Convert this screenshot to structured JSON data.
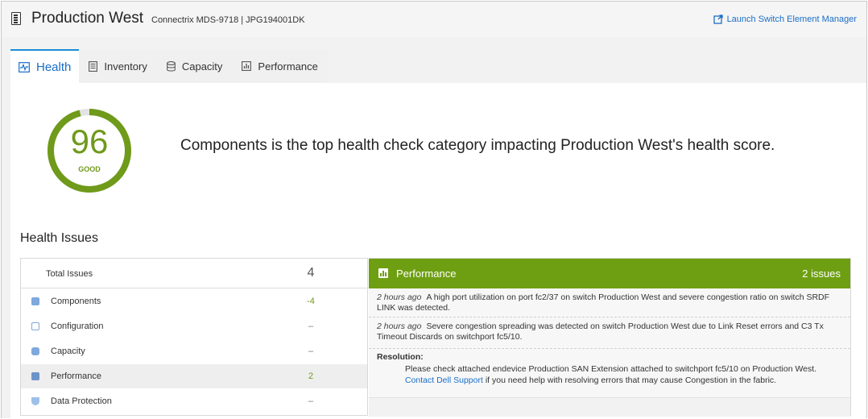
{
  "header": {
    "title": "Production West",
    "subtitle": "Connectrix MDS-9718 | JPG194001DK",
    "launch_label": "Launch Switch Element Manager"
  },
  "tabs": [
    {
      "label": "Health",
      "icon": "health-icon",
      "active": true
    },
    {
      "label": "Inventory",
      "icon": "inventory-icon",
      "active": false
    },
    {
      "label": "Capacity",
      "icon": "capacity-icon",
      "active": false
    },
    {
      "label": "Performance",
      "icon": "performance-icon",
      "active": false
    }
  ],
  "health": {
    "score": "96",
    "score_value": 96,
    "rating": "GOOD",
    "summary": "Components is the top health check category impacting Production West's health score."
  },
  "issues": {
    "title": "Health Issues",
    "total_label": "Total Issues",
    "total_value": "4",
    "categories": [
      {
        "label": "Components",
        "value": "-4",
        "icon": "components-icon"
      },
      {
        "label": "Configuration",
        "value": "–",
        "icon": "configuration-icon"
      },
      {
        "label": "Capacity",
        "value": "–",
        "icon": "capacity-icon"
      },
      {
        "label": "Performance",
        "value": "2",
        "icon": "performance-icon",
        "selected": true
      },
      {
        "label": "Data Protection",
        "value": "–",
        "icon": "shield-icon"
      }
    ]
  },
  "detail": {
    "title": "Performance",
    "count": "2 issues",
    "entries": [
      {
        "time": "2 hours ago",
        "text": "A high port utilization on port fc2/37 on switch Production West and severe congestion ratio on switch SRDF LINK was detected."
      },
      {
        "time": "2 hours ago",
        "text": "Severe congestion spreading was detected on switch Production West due to Link Reset errors and C3 Tx Timeout Discards on switchport fc5/10."
      }
    ],
    "resolution_label": "Resolution:",
    "resolution_text_a": "Please check attached endevice Production SAN Extension attached to switchport fc5/10 on Production West.",
    "resolution_link": "Contact Dell Support",
    "resolution_text_b": "if you need help with resolving errors that may cause Congestion in the fabric."
  },
  "colors": {
    "accent": "#1a6ec8",
    "good": "#6f9a1a",
    "panel_header": "#6e9f12"
  }
}
